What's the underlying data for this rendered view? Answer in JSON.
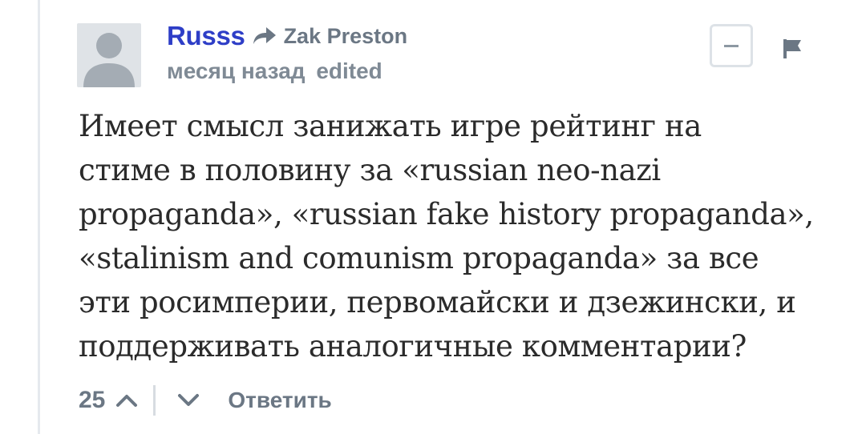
{
  "comment": {
    "author": "Russs",
    "reply_to": "Zak Preston",
    "time_ago": "месяц назад",
    "edited_label": "edited",
    "body_lines": [
      "Имеет смысл занижать игре рейтинг на",
      "стиме в половину за «russian neo-nazi",
      "propaganda», «russian fake history propaganda»,",
      "«stalinism and comunism propaganda» за все",
      "эти росимперии, первомайски и дзежински, и",
      "поддерживать аналогичные комментарии?"
    ],
    "votes": "25",
    "reply_label": "Ответить"
  },
  "icons": {
    "avatar": "default-avatar-icon",
    "reply_to": "reply-arrow-icon",
    "collapse": "minus-icon",
    "flag": "flag-icon",
    "upvote": "chevron-up-icon",
    "downvote": "chevron-down-icon"
  },
  "colors": {
    "author": "#2e3ec7",
    "muted": "#6b7784",
    "body": "#2b2b2b",
    "avatar_bg": "#dfe3e7",
    "avatar_fg": "#a4acb4"
  }
}
